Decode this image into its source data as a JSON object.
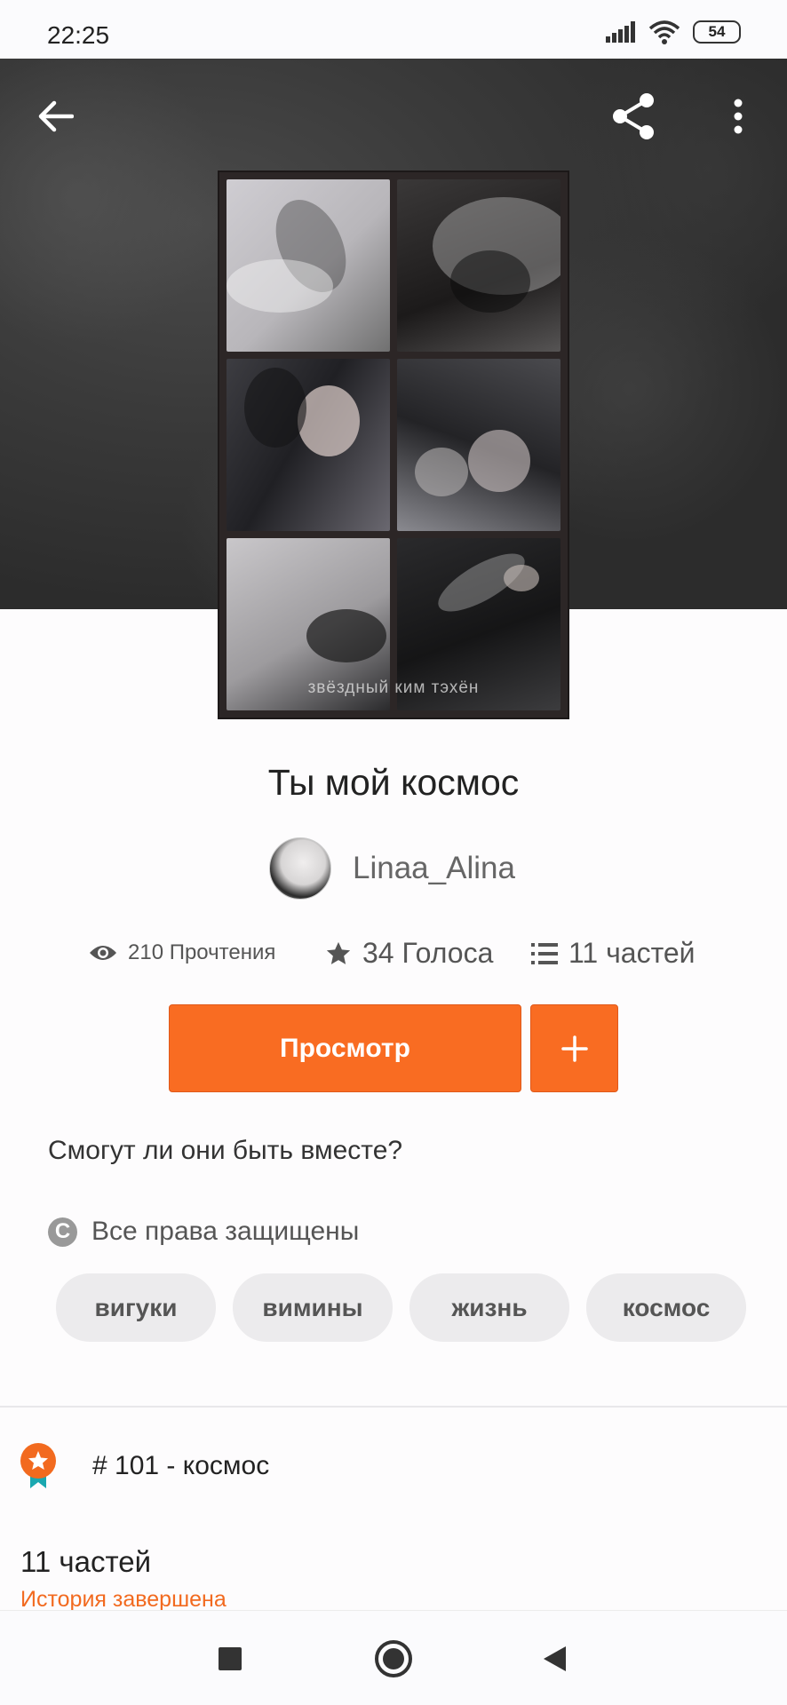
{
  "status_bar": {
    "time": "22:25",
    "battery": "54"
  },
  "header": {
    "back_icon": "arrow-left-icon",
    "share_icon": "share-icon",
    "more_icon": "more-vertical-icon"
  },
  "cover": {
    "caption": "звёздный ким тэхён"
  },
  "story": {
    "title": "Ты мой космос",
    "author": "Linaa_Alina",
    "reads": "210 Прочтения",
    "votes": "34 Голоса",
    "parts": "11 частей",
    "description": "Смогут ли они быть вместе?",
    "copyright": "Все права защищены",
    "copyright_icon": "C"
  },
  "actions": {
    "read_label": "Просмотр",
    "add_label": "+"
  },
  "tags": [
    "вигуки",
    "вимины",
    "жизнь",
    "космос"
  ],
  "ranking": {
    "text": "# 101 - космос"
  },
  "toc": {
    "parts_count": "11 частей",
    "status": "История завершена"
  },
  "colors": {
    "accent": "#f96c22",
    "status_orange": "#f26a1f"
  }
}
